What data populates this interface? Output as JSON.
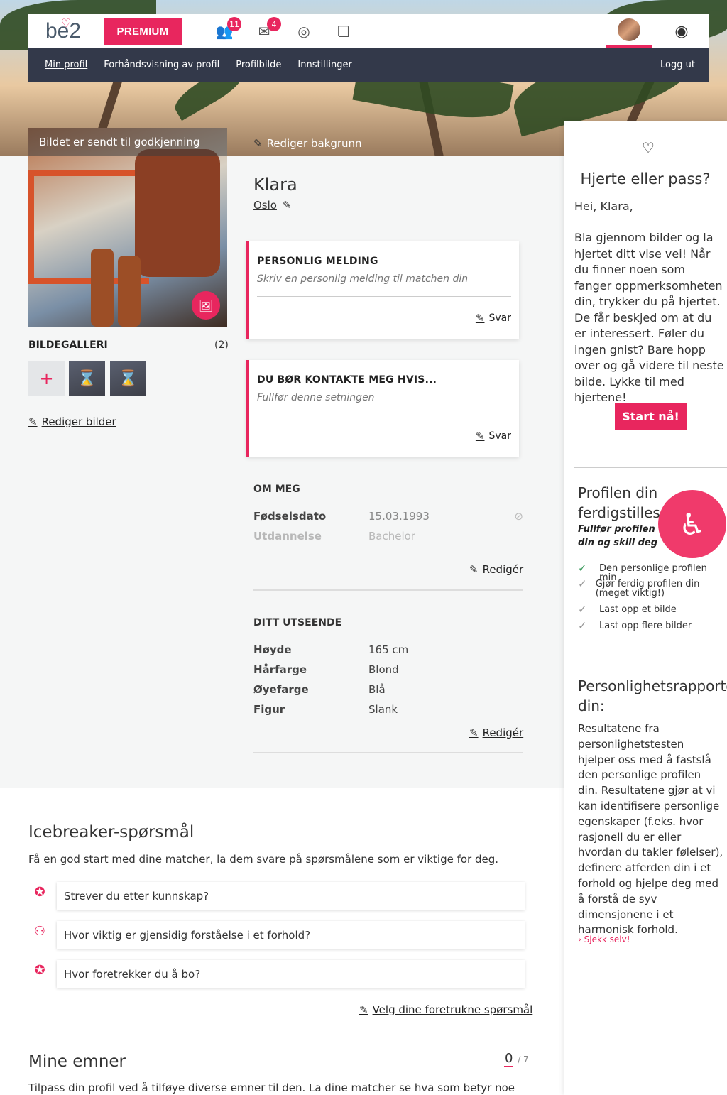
{
  "topbar": {
    "logo": "be2",
    "premium": "PREMIUM",
    "visitors_badge": "11",
    "messages_badge": "4"
  },
  "subnav": {
    "items": [
      "Min profil",
      "Forhåndsvisning av profil",
      "Profilbilde",
      "Innstillinger"
    ],
    "logout": "Logg ut"
  },
  "photo": {
    "banner": "Bildet er sendt til godkjenning",
    "edit_background": "Rediger bakgrunn"
  },
  "gallery": {
    "title": "BILDEGALLERI",
    "count": "(2)",
    "add": "+",
    "edit": "Rediger bilder"
  },
  "profile": {
    "name": "Klara",
    "city": "Oslo"
  },
  "cards": [
    {
      "title": "PERSONLIG MELDING",
      "placeholder": "Skriv en personlig melding til matchen din",
      "action": "Svar"
    },
    {
      "title": "DU BØR KONTAKTE MEG HVIS...",
      "placeholder": "Fullfør denne setningen",
      "action": "Svar"
    }
  ],
  "about": {
    "title": "OM MEG",
    "rows": [
      {
        "k": "Fødselsdato",
        "v": "15.03.1993"
      },
      {
        "k": "Utdannelse",
        "v": "Bachelor"
      }
    ],
    "edit": "Redigér"
  },
  "appearance": {
    "title": "DITT UTSEENDE",
    "rows": [
      {
        "k": "Høyde",
        "v": "165 cm"
      },
      {
        "k": "Hårfarge",
        "v": "Blond"
      },
      {
        "k": "Øyefarge",
        "v": "Blå"
      },
      {
        "k": "Figur",
        "v": "Slank"
      }
    ],
    "edit": "Redigér"
  },
  "sidebar": {
    "heart_title": "Hjerte eller pass?",
    "greeting": "Hei, Klara,",
    "text": "Bla gjennom bilder og la hjertet ditt vise vei! Når du finner noen som fanger oppmerksomheten din, trykker du på hjertet. De får beskjed om at du er interessert. Føler du ingen gnist? Bare hopp over og gå videre til neste bilde. Lykke til med hjertene!",
    "start": "Start nå!",
    "complete_title": "Profilen din ferdigstilles",
    "complete_sub": "Fullfør profilen din og skill deg ut fra mengden!",
    "checklist": [
      "Den personlige profilen min",
      "Gjør ferdig profilen din (meget viktig!)",
      "Last opp et bilde",
      "Last opp flere bilder"
    ],
    "report_title": "Personlighetsrapporten din:",
    "report_text": "Resultatene fra personlighetstesten hjelper oss med å fastslå den personlige profilen din. Resultatene gjør at vi kan identifisere personlige egenskaper (f.eks. hvor rasjonell du er eller hvordan du takler følelser), definere atferden din i et forhold og hjelpe deg med å forstå de syv dimensjonene i et harmonisk forhold.",
    "report_link": "Sjekk selv!"
  },
  "icebreaker": {
    "title": "Icebreaker-spørsmål",
    "subtitle": "Få en god start med dine matcher, la dem svare på spørsmålene som er viktige for deg.",
    "questions": [
      "Strever du etter kunnskap?",
      "Hvor viktig er gjensidig forståelse i et forhold?",
      "Hvor foretrekker du å bo?"
    ],
    "choose": "Velg dine foretrukne spørsmål"
  },
  "topics": {
    "title": "Mine emner",
    "count": "0",
    "total": "/ 7",
    "subtitle": "Tilpass din profil ved å tilføye diverse emner til den. La dine matcher se hva som betyr noe for deg,"
  }
}
